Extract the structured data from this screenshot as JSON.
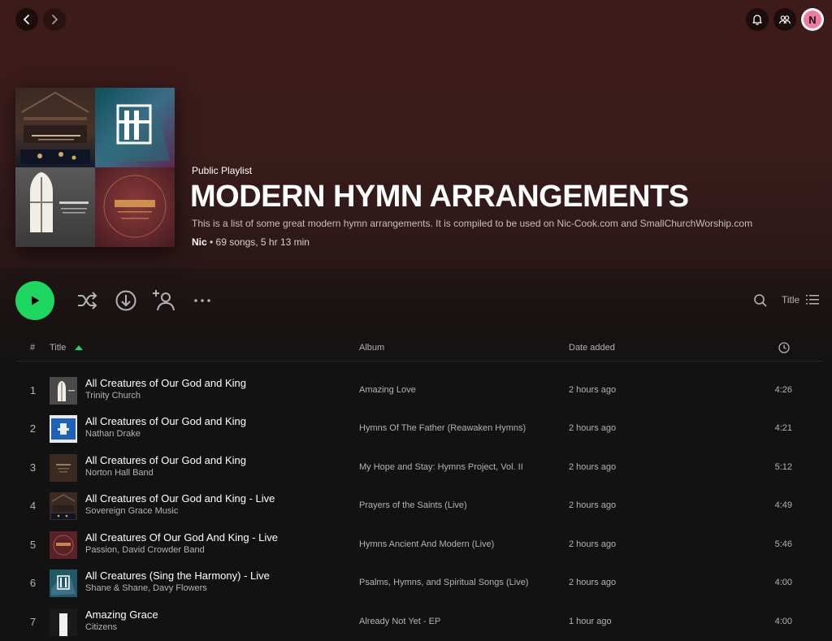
{
  "colors": {
    "accent": "#1ed760",
    "header_bg": "#3e1b1b",
    "body_bg": "#121212",
    "avatar_bg": "#f07ba1"
  },
  "topbar": {
    "back_icon": "chevron-left-icon",
    "forward_icon": "chevron-right-icon",
    "notifications_icon": "bell-icon",
    "friends_icon": "friends-icon",
    "avatar_initial": "N"
  },
  "playlist": {
    "type_label": "Public Playlist",
    "title": "MODERN HYMN ARRANGEMENTS",
    "description": "This is a list of some great modern hymn arrangements. It is compiled to be used on Nic-Cook.com and SmallChurchWorship.com",
    "owner": "Nic",
    "stats": " • 69 songs, 5 hr 13 min"
  },
  "actions": {
    "play_icon": "play-icon",
    "shuffle_icon": "shuffle-icon",
    "download_icon": "download-icon",
    "add_user_icon": "add-user-icon",
    "more_icon": "more-icon",
    "search_icon": "search-icon",
    "sort_label": "Title",
    "sort_icon": "list-icon"
  },
  "table": {
    "headers": {
      "number": "#",
      "title": "Title",
      "album": "Album",
      "date_added": "Date added",
      "duration_icon": "clock-icon"
    },
    "sort_indicator": "sort-asc-icon",
    "rows": [
      {
        "num": "1",
        "title": "All Creatures of Our God and King",
        "artist": "Trinity Church",
        "album": "Amazing Love",
        "date": "2 hours ago",
        "duration": "4:26"
      },
      {
        "num": "2",
        "title": "All Creatures of Our God and King",
        "artist": "Nathan Drake",
        "album": "Hymns Of The Father (Reawaken Hymns)",
        "date": "2 hours ago",
        "duration": "4:21"
      },
      {
        "num": "3",
        "title": "All Creatures of Our God and King",
        "artist": "Norton Hall Band",
        "album": "My Hope and Stay: Hymns Project, Vol. II",
        "date": "2 hours ago",
        "duration": "5:12"
      },
      {
        "num": "4",
        "title": "All Creatures of Our God and King - Live",
        "artist": "Sovereign Grace Music",
        "album": "Prayers of the Saints (Live)",
        "date": "2 hours ago",
        "duration": "4:49"
      },
      {
        "num": "5",
        "title": "All Creatures Of Our God And King - Live",
        "artist": "Passion, David Crowder Band",
        "album": "Hymns Ancient And Modern (Live)",
        "date": "2 hours ago",
        "duration": "5:46"
      },
      {
        "num": "6",
        "title": "All Creatures (Sing the Harmony) - Live",
        "artist": "Shane & Shane, Davy Flowers",
        "album": "Psalms, Hymns, and Spiritual Songs (Live)",
        "date": "2 hours ago",
        "duration": "4:00"
      },
      {
        "num": "7",
        "title": "Amazing Grace",
        "artist": "Citizens",
        "album": "Already Not Yet - EP",
        "date": "1 hour ago",
        "duration": "4:00"
      }
    ]
  }
}
